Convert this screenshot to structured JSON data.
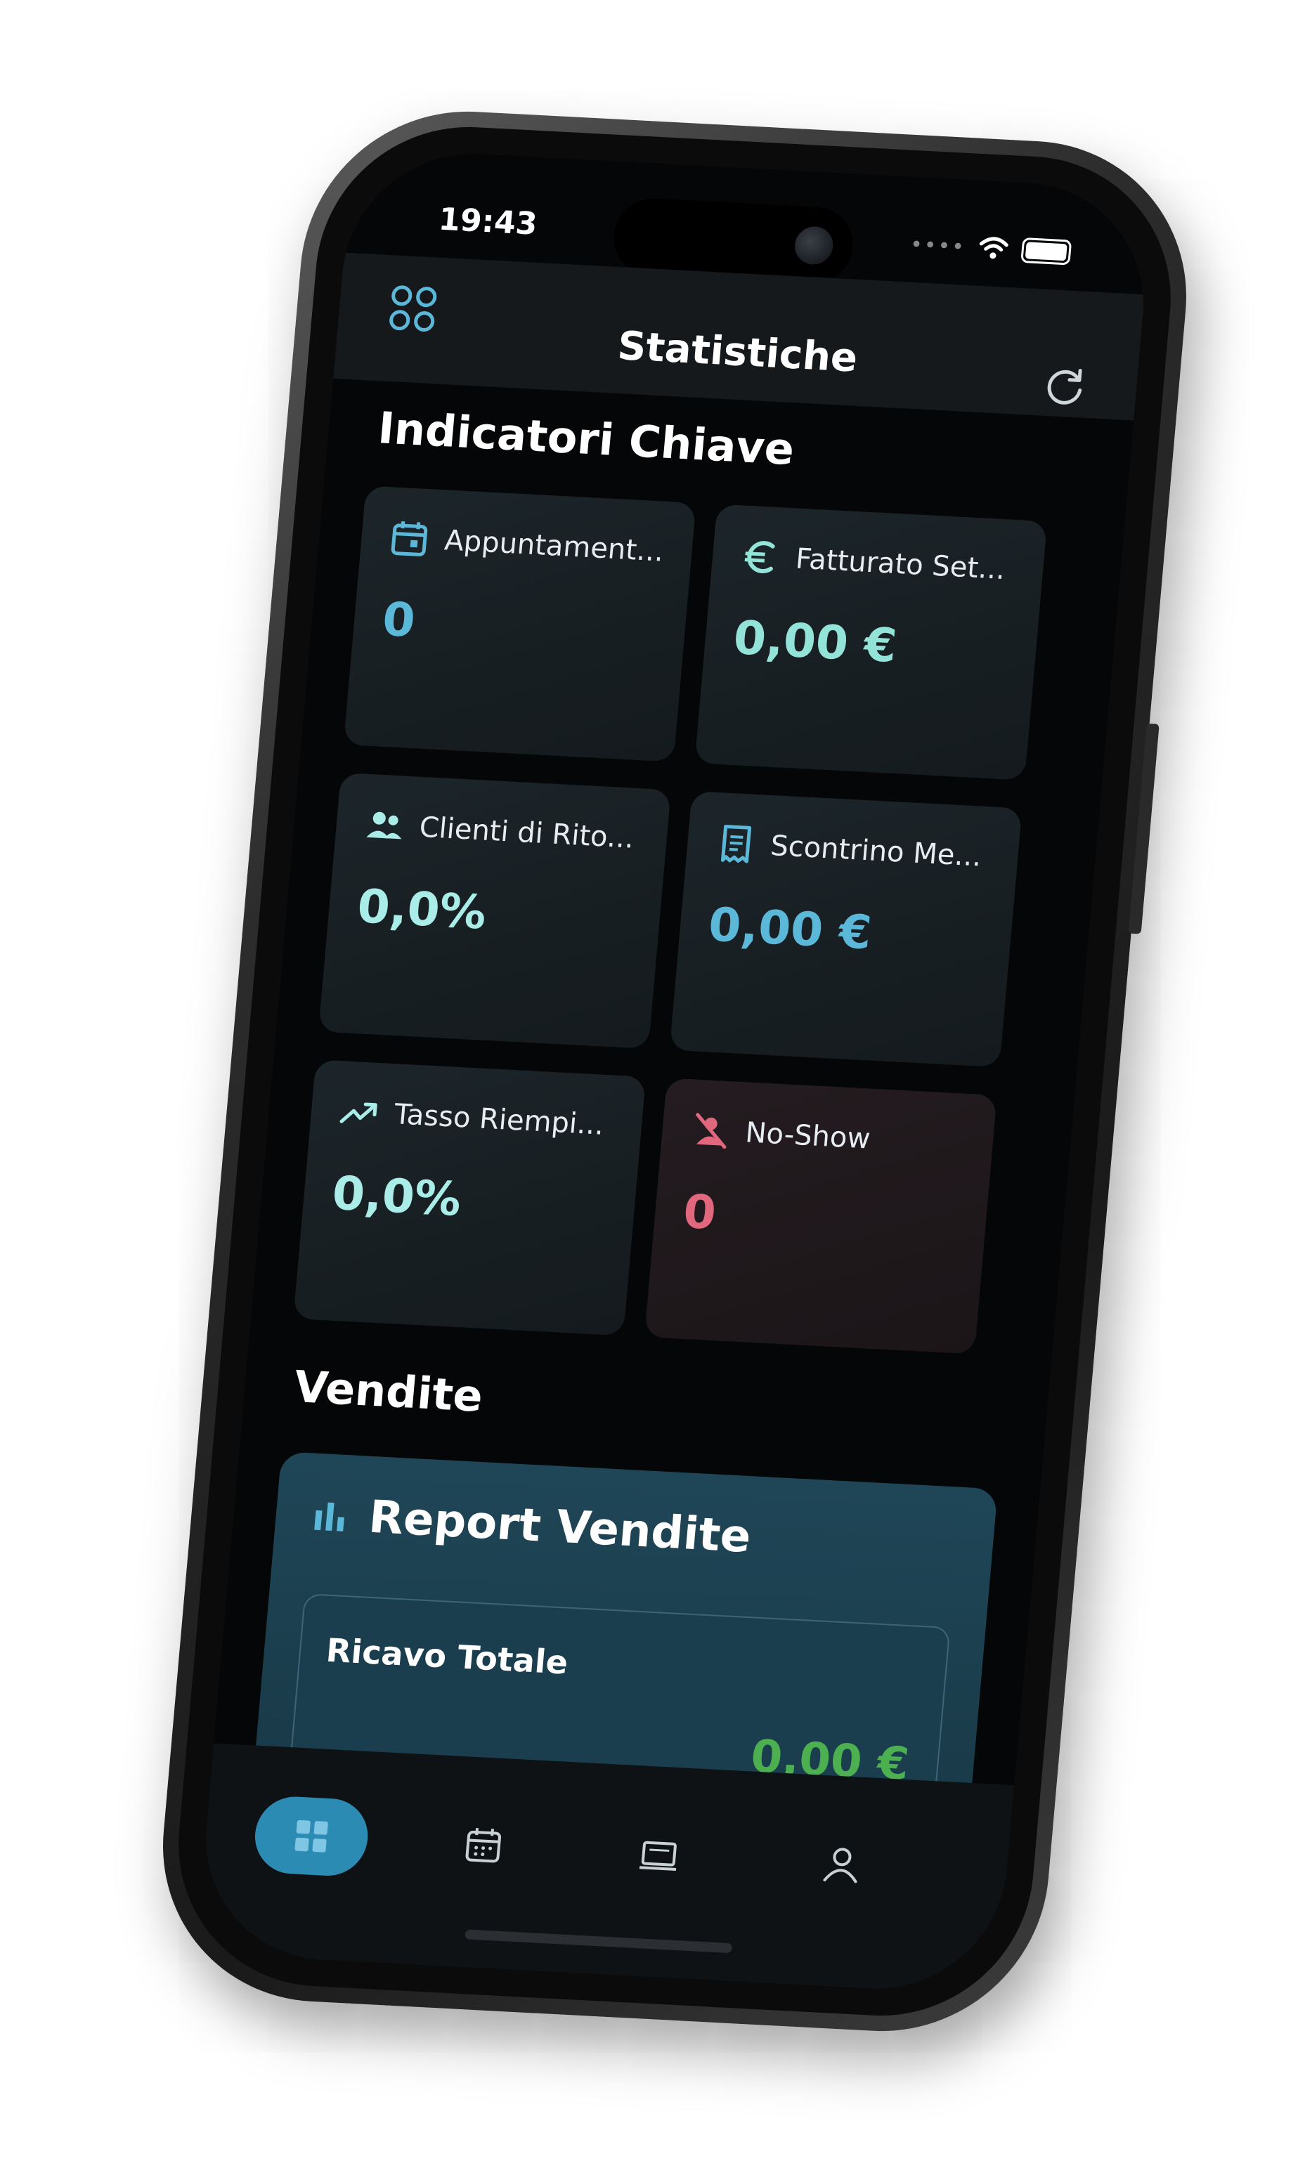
{
  "status_bar": {
    "time": "19:43"
  },
  "header": {
    "title": "Statistiche"
  },
  "sections": {
    "kpi_title": "Indicatori Chiave",
    "sales_title": "Vendite"
  },
  "kpis": [
    {
      "label": "Appuntament...",
      "value": "0",
      "icon": "calendar-icon",
      "color": "#5bb8d8"
    },
    {
      "label": "Fatturato Set...",
      "value": "0,00 €",
      "icon": "euro-icon",
      "color": "#93e3d8"
    },
    {
      "label": "Clienti di Rito...",
      "value": "0,0%",
      "icon": "people-icon",
      "color": "#a9ece8"
    },
    {
      "label": "Scontrino Me...",
      "value": "0,00 €",
      "icon": "receipt-icon",
      "color": "#5bb8d8"
    },
    {
      "label": "Tasso Riempi...",
      "value": "0,0%",
      "icon": "trending-up-icon",
      "color": "#a9ece8"
    },
    {
      "label": "No-Show",
      "value": "0",
      "icon": "person-off-icon",
      "color": "#e0677e"
    }
  ],
  "report": {
    "title": "Report Vendite",
    "revenue_label": "Ricavo Totale",
    "revenue_value": "0,00 €",
    "revenue_color": "#4caf50"
  },
  "tabs": [
    {
      "icon": "dashboard-icon",
      "active": true
    },
    {
      "icon": "calendar-icon",
      "active": false
    },
    {
      "icon": "register-icon",
      "active": false
    },
    {
      "icon": "profile-icon",
      "active": false
    }
  ],
  "colors": {
    "accent": "#2c8bb3",
    "teal": "#93e3d8",
    "alert": "#e0677e",
    "background": "#050607"
  }
}
